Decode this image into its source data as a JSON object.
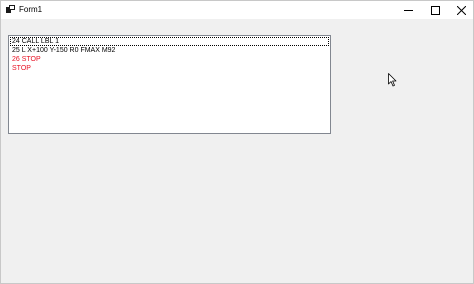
{
  "window": {
    "title": "Form1"
  },
  "titlebar": {
    "icon": "app-form-icon",
    "minimize_icon": "minimize-icon",
    "maximize_icon": "maximize-icon",
    "close_icon": "close-icon"
  },
  "listbox": {
    "items": [
      {
        "text": "24 CALL LBL 1",
        "color": "#000000",
        "focused": true
      },
      {
        "text": "25 L X+100 Y-150 R0 FMAX M92",
        "color": "#000000"
      },
      {
        "text": "26 STOP",
        "color": "#e81123"
      },
      {
        "text": "STOP",
        "color": "#e81123"
      }
    ]
  },
  "colors": {
    "window_bg": "#f0f0f0",
    "list_bg": "#ffffff",
    "highlight_text": "#e81123"
  }
}
